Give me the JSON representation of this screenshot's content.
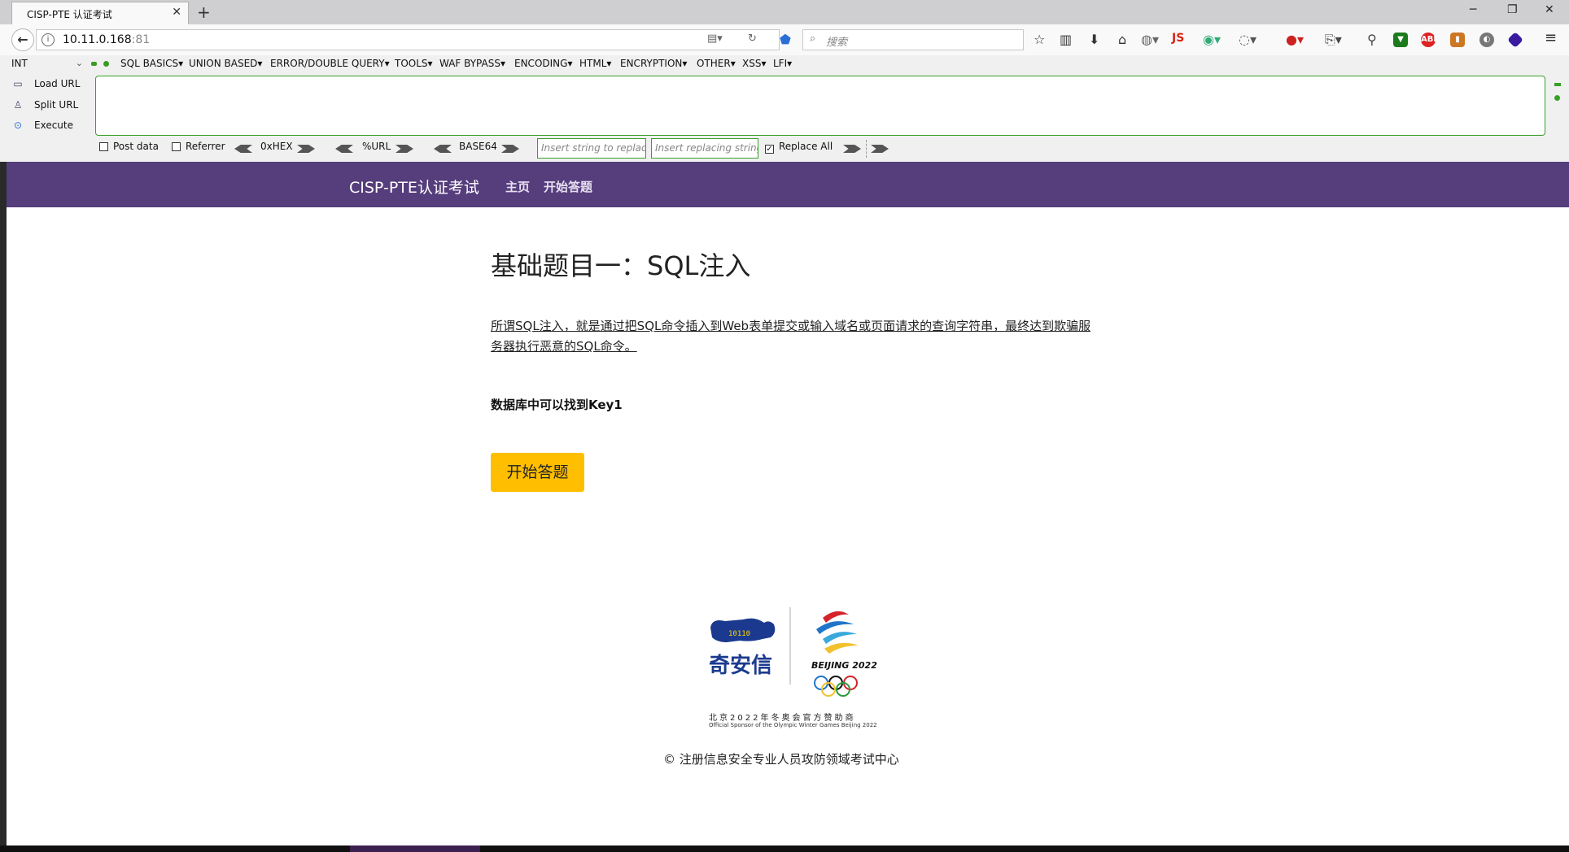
{
  "tab": {
    "title": "CISP-PTE 认证考试",
    "close": "✕",
    "new_tab": "+"
  },
  "window": {
    "minimize": "─",
    "restore": "❐",
    "close": "✕"
  },
  "address": {
    "host": "10.11.0.168",
    "port": ":81"
  },
  "search": {
    "placeholder": "搜索"
  },
  "extensions": {
    "js_label": "JS",
    "abp_label": "ABP"
  },
  "hackbar": {
    "select_value": "INT",
    "menus": [
      "SQL BASICS",
      "UNION BASED",
      "ERROR/DOUBLE QUERY",
      "TOOLS",
      "WAF BYPASS",
      "ENCODING",
      "HTML",
      "ENCRYPTION",
      "OTHER",
      "XSS",
      "LFI"
    ],
    "load_url": "Load URL",
    "split_url": "Split URL",
    "execute": "Execute",
    "post_data": "Post data",
    "referrer": "Referrer",
    "hex": "0xHEX",
    "url_enc": "%URL",
    "base64": "BASE64",
    "replace_placeholder": "Insert string to replace",
    "replacing_placeholder": "Insert replacing string",
    "replace_all": "Replace All"
  },
  "site": {
    "brand": "CISP-PTE认证考试",
    "nav_home": "主页",
    "nav_start": "开始答题"
  },
  "main": {
    "title": "基础题目一：SQL注入",
    "description": "所谓SQL注入，就是通过把SQL命令插入到Web表单提交或输入域名或页面请求的查询字符串，最终达到欺骗服务器执行恶意的SQL命令。",
    "hint": "数据库中可以找到Key1",
    "start_button": "开始答题"
  },
  "sponsor": {
    "company": "奇安信",
    "games": "BEIJING 2022",
    "line1": "北京2022年冬奥会官方赞助商",
    "line2": "Official Sponsor of the Olympic Winter Games Beijing 2022"
  },
  "footer": {
    "copyright": "© 注册信息安全专业人员攻防领域考试中心"
  },
  "colors": {
    "nav_bg": "#563d7c",
    "button_bg": "#ffbf00",
    "hackbar_green": "#39a02a"
  }
}
